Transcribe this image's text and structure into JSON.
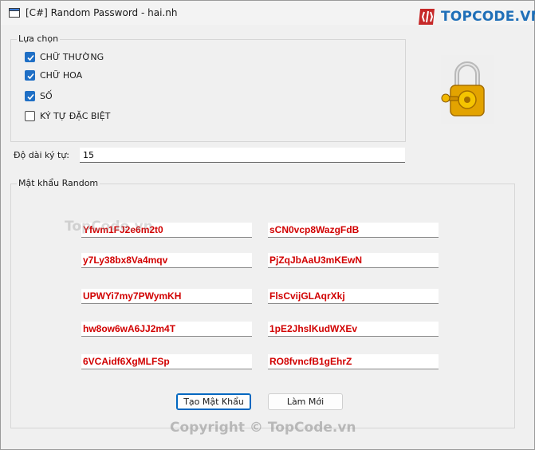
{
  "window": {
    "title": "[C#] Random Password - hai.nh"
  },
  "brand": {
    "logo_text": "TOPCODE.VN",
    "watermark": "TopCode.vn",
    "copyright": "Copyright © TopCode.vn"
  },
  "options": {
    "legend": "Lựa chọn",
    "items": [
      {
        "label": "CHỮ THƯỜNG",
        "checked": true
      },
      {
        "label": "CHỮ HOA",
        "checked": true
      },
      {
        "label": "SỐ",
        "checked": true
      },
      {
        "label": "KÝ TỰ ĐẶC BIỆT",
        "checked": false
      }
    ]
  },
  "length": {
    "label": "Độ dài ký tự:",
    "value": "15"
  },
  "random": {
    "legend": "Mật khẩu Random",
    "passwords_left": [
      "Yfwm1FJ2e6m2t0",
      "y7Ly38bx8Va4mqv",
      "UPWYi7my7PWymKH",
      "hw8ow6wA6JJ2m4T",
      "6VCAidf6XgMLFSp"
    ],
    "passwords_right": [
      "sCN0vcp8WazgFdB",
      "PjZqJbAaU3mKEwN",
      "FlsCvijGLAqrXkj",
      "1pE2JhslKudWXEv",
      "RO8fvncfB1gEhrZ"
    ]
  },
  "buttons": {
    "generate": "Tạo Mật Khẩu",
    "reset": "Làm Mới"
  },
  "colors": {
    "accent": "#1f6fc5",
    "password_text": "#d10000",
    "logo": "#1f6fb8"
  },
  "icons": {
    "app": "window-app-icon",
    "lock": "padlock-with-key-icon"
  }
}
